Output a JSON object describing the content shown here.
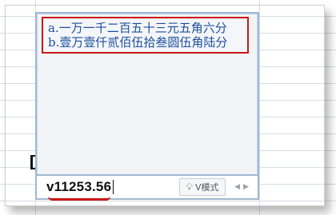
{
  "ime": {
    "candidates": [
      {
        "key": "a.",
        "text": "一万一千二百五十三元五角六分"
      },
      {
        "key": "b.",
        "text": "壹万壹仟贰佰伍拾叁圆伍角陆分"
      }
    ],
    "input_value": "v11253.56",
    "mode_label": "V模式",
    "mode_icon": "lightbulb-icon",
    "prev_icon": "triangle-left",
    "next_icon": "triangle-right",
    "highlight_color": "#c81818",
    "candidate_color": "#1e4f9c"
  }
}
